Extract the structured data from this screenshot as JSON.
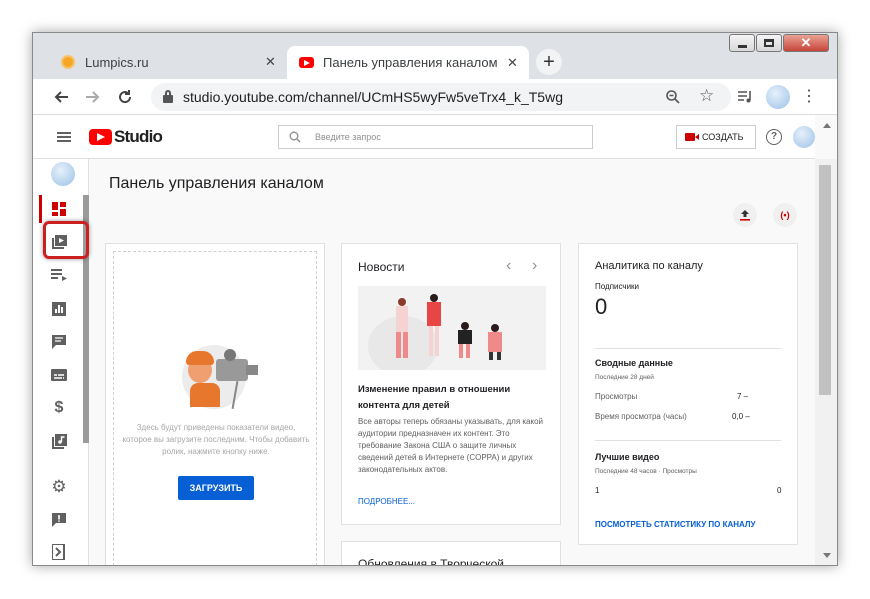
{
  "browser": {
    "tabs": [
      {
        "title": "Lumpics.ru",
        "icon": "orange-circle-icon"
      },
      {
        "title": "Панель управления каналом - Y",
        "icon": "youtube-icon"
      }
    ],
    "url": "studio.youtube.com/channel/UCmHS5wyFw5veTrx4_k_T5wg"
  },
  "studio": {
    "logo_text": "Studio",
    "search_placeholder": "Введите запрос",
    "create_label": "СОЗДАТЬ",
    "page_title": "Панель управления каналом"
  },
  "upload_card": {
    "text": "Здесь будут приведены показатели видео, которое вы загрузите последним. Чтобы добавить ролик, нажмите кнопку ниже.",
    "button": "ЗАГРУЗИТЬ"
  },
  "news_card": {
    "title": "Новости",
    "headline": "Изменение правил в отношении контента для детей",
    "body": "Все авторы теперь обязаны указывать, для какой аудитории предназначен их контент. Это требование Закона США о защите личных сведений детей в Интернете (COPPA) и других законодательных актов.",
    "link": "ПОДРОБНЕЕ..."
  },
  "updates_card": {
    "title": "Обновления в Творческой студии"
  },
  "analytics": {
    "title": "Аналитика по каналу",
    "subs_label": "Подписчики",
    "subs_value": "0",
    "summary_title": "Сводные данные",
    "summary_period": "Последние 28 дней",
    "views_label": "Просмотры",
    "views_value": "7 –",
    "watch_label": "Время просмотра (часы)",
    "watch_value": "0,0 –",
    "top_title": "Лучшие видео",
    "top_period": "Последние 48 часов · Просмотры",
    "top_row_left": "1",
    "top_row_right": "0",
    "link": "ПОСМОТРЕТЬ СТАТИСТИКУ ПО КАНАЛУ"
  },
  "colors": {
    "brand_red": "#ff0000",
    "link_blue": "#065fd4",
    "highlight": "#cc2020"
  }
}
